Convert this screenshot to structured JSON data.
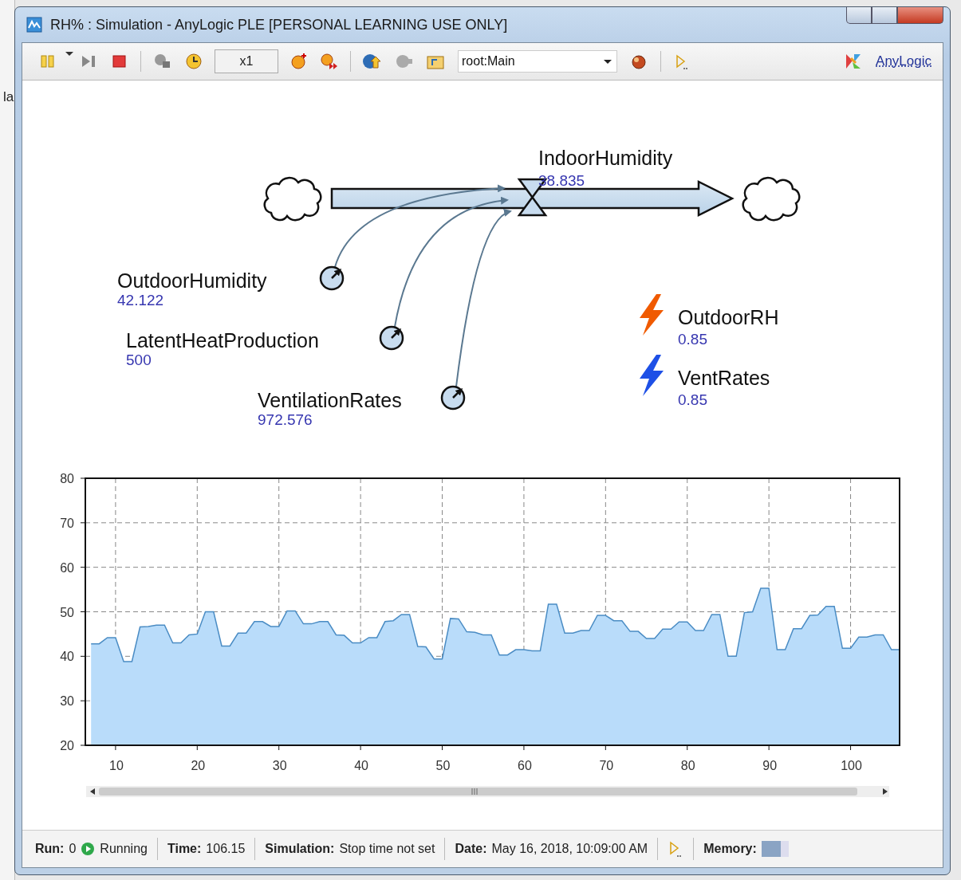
{
  "background_app": {
    "text": "la"
  },
  "window": {
    "title": "RH% : Simulation - AnyLogic PLE [PERSONAL LEARNING USE ONLY]"
  },
  "toolbar": {
    "speed": "x1",
    "experiment": "root:Main",
    "brand": "AnyLogic"
  },
  "diagram": {
    "stock": {
      "name": "IndoorHumidity",
      "value": "38.835"
    },
    "auxiliaries": [
      {
        "name": "OutdoorHumidity",
        "value": "42.122"
      },
      {
        "name": "LatentHeatProduction",
        "value": "500"
      },
      {
        "name": "VentilationRates",
        "value": "972.576"
      }
    ],
    "parameters": [
      {
        "name": "OutdoorRH",
        "value": "0.85",
        "color": "#f05a00"
      },
      {
        "name": "VentRates",
        "value": "0.85",
        "color": "#1e50e6"
      }
    ]
  },
  "chart": {
    "chart_data": {
      "type": "area",
      "grid": true,
      "xlim": [
        6.3,
        106
      ],
      "ylim": [
        20,
        80
      ],
      "xticks": [
        10,
        20,
        30,
        40,
        50,
        60,
        70,
        80,
        90,
        100
      ],
      "yticks": [
        20,
        30,
        40,
        50,
        60,
        70,
        80
      ],
      "x": [
        7,
        8,
        9,
        10,
        11,
        12,
        13,
        14,
        15,
        16,
        17,
        18,
        19,
        20,
        21,
        22,
        23,
        24,
        25,
        26,
        27,
        28,
        29,
        30,
        31,
        32,
        33,
        34,
        35,
        36,
        37,
        38,
        39,
        40,
        41,
        42,
        43,
        44,
        45,
        46,
        47,
        48,
        49,
        50,
        51,
        52,
        53,
        54,
        55,
        56,
        57,
        58,
        59,
        60,
        61,
        62,
        63,
        64,
        65,
        66,
        67,
        68,
        69,
        70,
        71,
        72,
        73,
        74,
        75,
        76,
        77,
        78,
        79,
        80,
        81,
        82,
        83,
        84,
        85,
        86,
        87,
        88,
        89,
        90,
        91,
        92,
        93,
        94,
        95,
        96,
        97,
        98,
        99,
        100,
        101,
        102,
        103,
        104,
        105,
        106
      ],
      "series": [
        {
          "color": "#b9dcfa",
          "values": [
            42.8,
            42.8,
            44.2,
            44.2,
            38.8,
            38.8,
            46.6,
            46.7,
            47,
            47,
            43,
            43,
            44.8,
            45,
            50,
            50,
            42.3,
            42.3,
            45.2,
            45.2,
            47.8,
            47.8,
            46.7,
            46.7,
            50.2,
            50.2,
            47.3,
            47.3,
            47.8,
            47.8,
            44.8,
            44.7,
            43,
            43,
            44.2,
            44.2,
            47.8,
            48,
            49.4,
            49.4,
            42.2,
            42.1,
            39.4,
            39.4,
            48.5,
            48.4,
            45.5,
            45.4,
            44.8,
            44.8,
            40.3,
            40.3,
            41.5,
            41.5,
            41.2,
            41.2,
            51.7,
            51.7,
            45.2,
            45.2,
            45.8,
            45.8,
            49.2,
            49.2,
            48,
            48,
            45.6,
            45.6,
            44,
            44,
            46.1,
            46.1,
            47.7,
            47.7,
            45.8,
            45.8,
            49.4,
            49.4,
            40,
            40,
            49.8,
            50,
            55.3,
            55.3,
            41.5,
            41.5,
            46.2,
            46.2,
            49.2,
            49.3,
            51.2,
            51.2,
            41.8,
            41.8,
            44.3,
            44.3,
            44.8,
            44.8,
            41.5,
            41.5
          ]
        }
      ]
    }
  },
  "status_bar": {
    "run": {
      "label": "Run:",
      "value": "0",
      "state": "Running",
      "kind": "running"
    },
    "fields": [
      {
        "label": "Time:",
        "value": "106.15"
      },
      {
        "label": "Simulation:",
        "value": "Stop time not set"
      },
      {
        "label": "Date:",
        "value": "May 16, 2018, 10:09:00 AM"
      }
    ],
    "memory": {
      "label": "Memory:"
    }
  }
}
